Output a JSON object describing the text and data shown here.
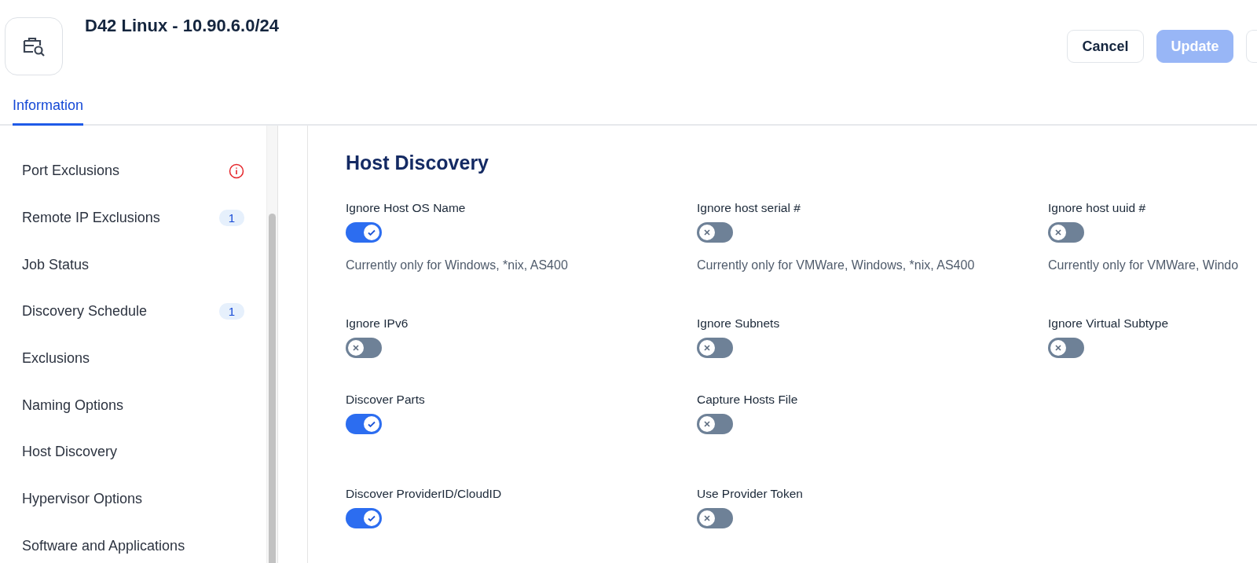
{
  "header": {
    "title": "D42 Linux - 10.90.6.0/24",
    "buttons": [
      {
        "label": "Cancel",
        "kind": "secondary"
      },
      {
        "label": "Update",
        "kind": "primary-disabled"
      }
    ]
  },
  "tabs": [
    {
      "label": "Information",
      "selected": true
    }
  ],
  "sidebar": {
    "items": [
      {
        "label": "Port Exclusions",
        "kind": "warning"
      },
      {
        "label": "Remote IP Exclusions",
        "kind": "count",
        "badge": "1"
      },
      {
        "label": "Job Status",
        "kind": "plain"
      },
      {
        "label": "Discovery Schedule",
        "kind": "count",
        "badge": "1"
      },
      {
        "label": "Exclusions",
        "kind": "plain"
      },
      {
        "label": "Naming Options",
        "kind": "plain"
      },
      {
        "label": "Host Discovery",
        "kind": "plain"
      },
      {
        "label": "Hypervisor Options",
        "kind": "plain"
      },
      {
        "label": "Software and Applications",
        "kind": "plain"
      }
    ]
  },
  "section": {
    "title": "Host Discovery",
    "rows": [
      [
        {
          "label": "Ignore Host OS Name",
          "on": true,
          "note": "Currently only for Windows, *nix, AS400"
        },
        {
          "label": "Ignore host serial #",
          "on": false,
          "note": "Currently only for VMWare, Windows, *nix, AS400"
        },
        {
          "label": "Ignore host uuid #",
          "on": false,
          "note": "Currently only for VMWare, Windo"
        }
      ],
      [
        {
          "label": "Ignore IPv6",
          "on": false
        },
        {
          "label": "Ignore Subnets",
          "on": false
        },
        {
          "label": "Ignore Virtual Subtype",
          "on": false
        }
      ],
      [
        {
          "label": "Discover Parts",
          "on": true
        },
        {
          "label": "Capture Hosts File",
          "on": false
        }
      ],
      [
        {
          "label": "Discover ProviderID/CloudID",
          "on": true
        },
        {
          "label": "Use Provider Token",
          "on": false
        }
      ]
    ]
  }
}
